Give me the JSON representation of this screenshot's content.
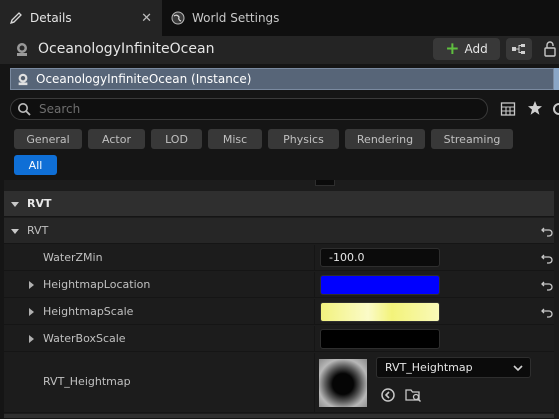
{
  "tabs": [
    {
      "label": "Details",
      "active": true,
      "icon": "pencil-icon"
    },
    {
      "label": "World Settings",
      "active": false,
      "icon": "globe-icon"
    }
  ],
  "header": {
    "actor_name": "OceanologyInfiniteOcean",
    "add_label": "Add"
  },
  "instance": {
    "label": "OceanologyInfiniteOcean (Instance)"
  },
  "search": {
    "placeholder": "Search"
  },
  "filters": [
    "General",
    "Actor",
    "LOD",
    "Misc",
    "Physics",
    "Rendering",
    "Streaming",
    "All"
  ],
  "active_filter": "All",
  "sections": {
    "category": "RVT",
    "subcategory": "RVT"
  },
  "properties": {
    "water_z_min": {
      "label": "WaterZMin",
      "value": "-100.0"
    },
    "heightmap_location": {
      "label": "HeightmapLocation",
      "color": "#0000ff"
    },
    "heightmap_scale": {
      "label": "HeightmapScale",
      "color": "#f4f47a"
    },
    "water_box_scale": {
      "label": "WaterBoxScale",
      "color": "#000000"
    },
    "rvt_heightmap": {
      "label": "RVT_Heightmap",
      "value": "RVT_Heightmap"
    }
  },
  "colors": {
    "accent": "#0f6fd6",
    "selection": "#576578",
    "add_plus": "#5fbf3f"
  }
}
